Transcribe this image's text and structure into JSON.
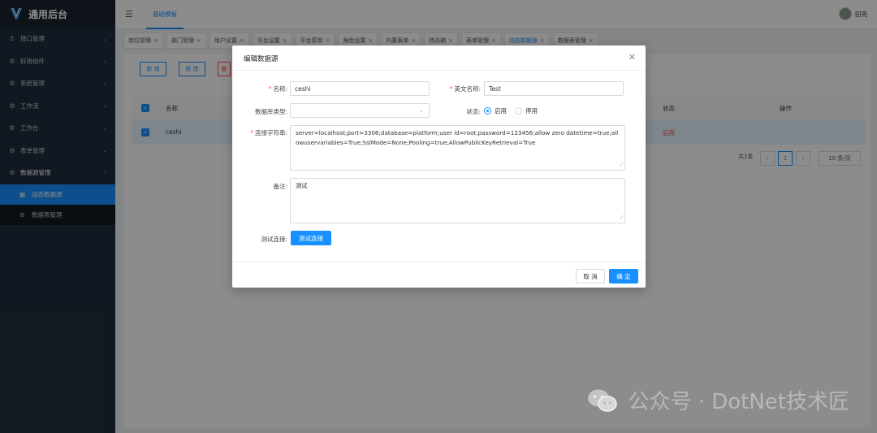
{
  "sidebar": {
    "brand": "通用后台",
    "items": [
      {
        "label": "接口管理",
        "icon": "anchor-icon"
      },
      {
        "label": "好用组件",
        "icon": "gear-icon"
      },
      {
        "label": "系统管理",
        "icon": "gear-icon"
      },
      {
        "label": "工作流",
        "icon": "gear-icon"
      },
      {
        "label": "工作台",
        "icon": "gear-icon"
      },
      {
        "label": "表单管理",
        "icon": "gear-icon"
      },
      {
        "label": "数据源管理",
        "icon": "gear-icon"
      }
    ],
    "subitems": [
      {
        "label": "动态数据源",
        "icon": "grid-icon"
      },
      {
        "label": "数据表管理",
        "icon": "gear-icon"
      }
    ]
  },
  "header": {
    "top_tab": "基础模板",
    "user_name": "田亮"
  },
  "tabs": [
    "岗位管理",
    "部门管理",
    "用户设置",
    "平台设置",
    "平台菜单",
    "角色设置",
    "内置表单",
    "待办箱",
    "表单管理",
    "动态数据源",
    "数据表管理"
  ],
  "toolbar": {
    "add": "新 增",
    "edit": "修 改",
    "delete": "删"
  },
  "table": {
    "headers": {
      "name": "名称",
      "status": "状态",
      "actions": "操作"
    },
    "row": {
      "name": "ceshi",
      "status": "启用"
    },
    "total": "共1条",
    "page": "1",
    "page_size": "10 条/页"
  },
  "dialog": {
    "title": "编辑数据源",
    "name_label": "名称:",
    "name_value": "ceshi",
    "en_name_label": "英文名称:",
    "en_name_value": "Test",
    "db_type_label": "数据库类型:",
    "db_type_value": "",
    "status_label": "状态:",
    "status_on": "启用",
    "status_off": "停用",
    "conn_label": "连接字符串:",
    "conn_value": "server=localhost;port=3306;database=platform;user id=root;password=123456;allow zero datetime=true;allowuservariables=True;SslMode=None;Pooling=true;AllowPublicKeyRetrieval=True",
    "remark_label": "备注:",
    "remark_value": "测试",
    "test_label": "测试连接:",
    "test_button": "测试连接",
    "cancel": "取 消",
    "ok": "确 定"
  },
  "watermark": "公众号 · DotNet技术匠",
  "colors": {
    "primary": "#1890ff",
    "sidebar": "#1f2d3d",
    "danger": "#ff4d4f"
  }
}
